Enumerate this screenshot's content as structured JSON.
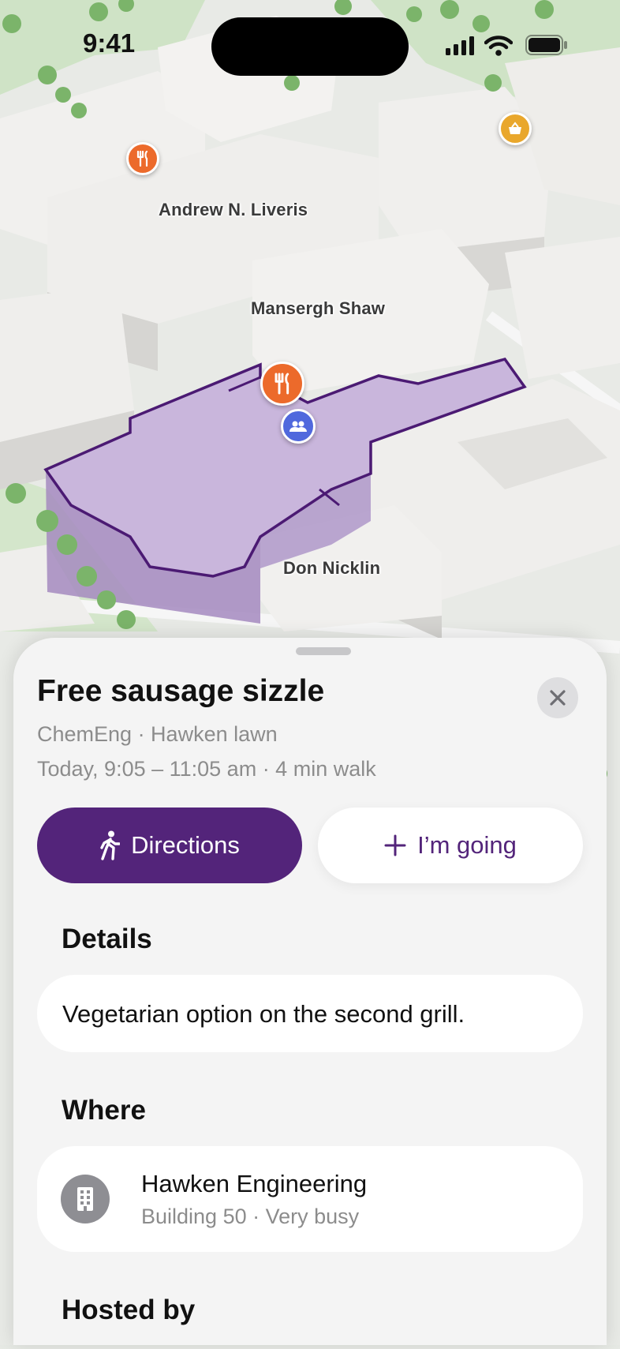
{
  "status_bar": {
    "time": "9:41"
  },
  "map": {
    "labels": {
      "andrew": "Andrew N. Liveris",
      "mansergh": "Mansergh Shaw",
      "don": "Don Nicklin"
    },
    "pins": {
      "restaurant_pin": "fork-knife-icon",
      "group_pin": "people-icon",
      "store_pin": "basket-icon"
    },
    "highlight_color": "#c9b6dc",
    "outline_color": "#4b1a73"
  },
  "sheet": {
    "title": "Free sausage sizzle",
    "location_line": "ChemEng · Hawken lawn",
    "time_line": "Today, 9:05 – 11:05 am · 4 min walk",
    "directions_label": "Directions",
    "going_label": "I’m going",
    "details_heading": "Details",
    "details_text": "Vegetarian option on the second grill.",
    "where_heading": "Where",
    "place_name": "Hawken Engineering",
    "place_sub": "Building 50 · Very busy",
    "hosted_heading": "Hosted by"
  },
  "colors": {
    "accent": "#53247a",
    "secondary_text": "#8c8c8c",
    "pin_orange": "#ec6a2b",
    "pin_blue": "#5068dd",
    "pin_yellow": "#e9a72c"
  }
}
